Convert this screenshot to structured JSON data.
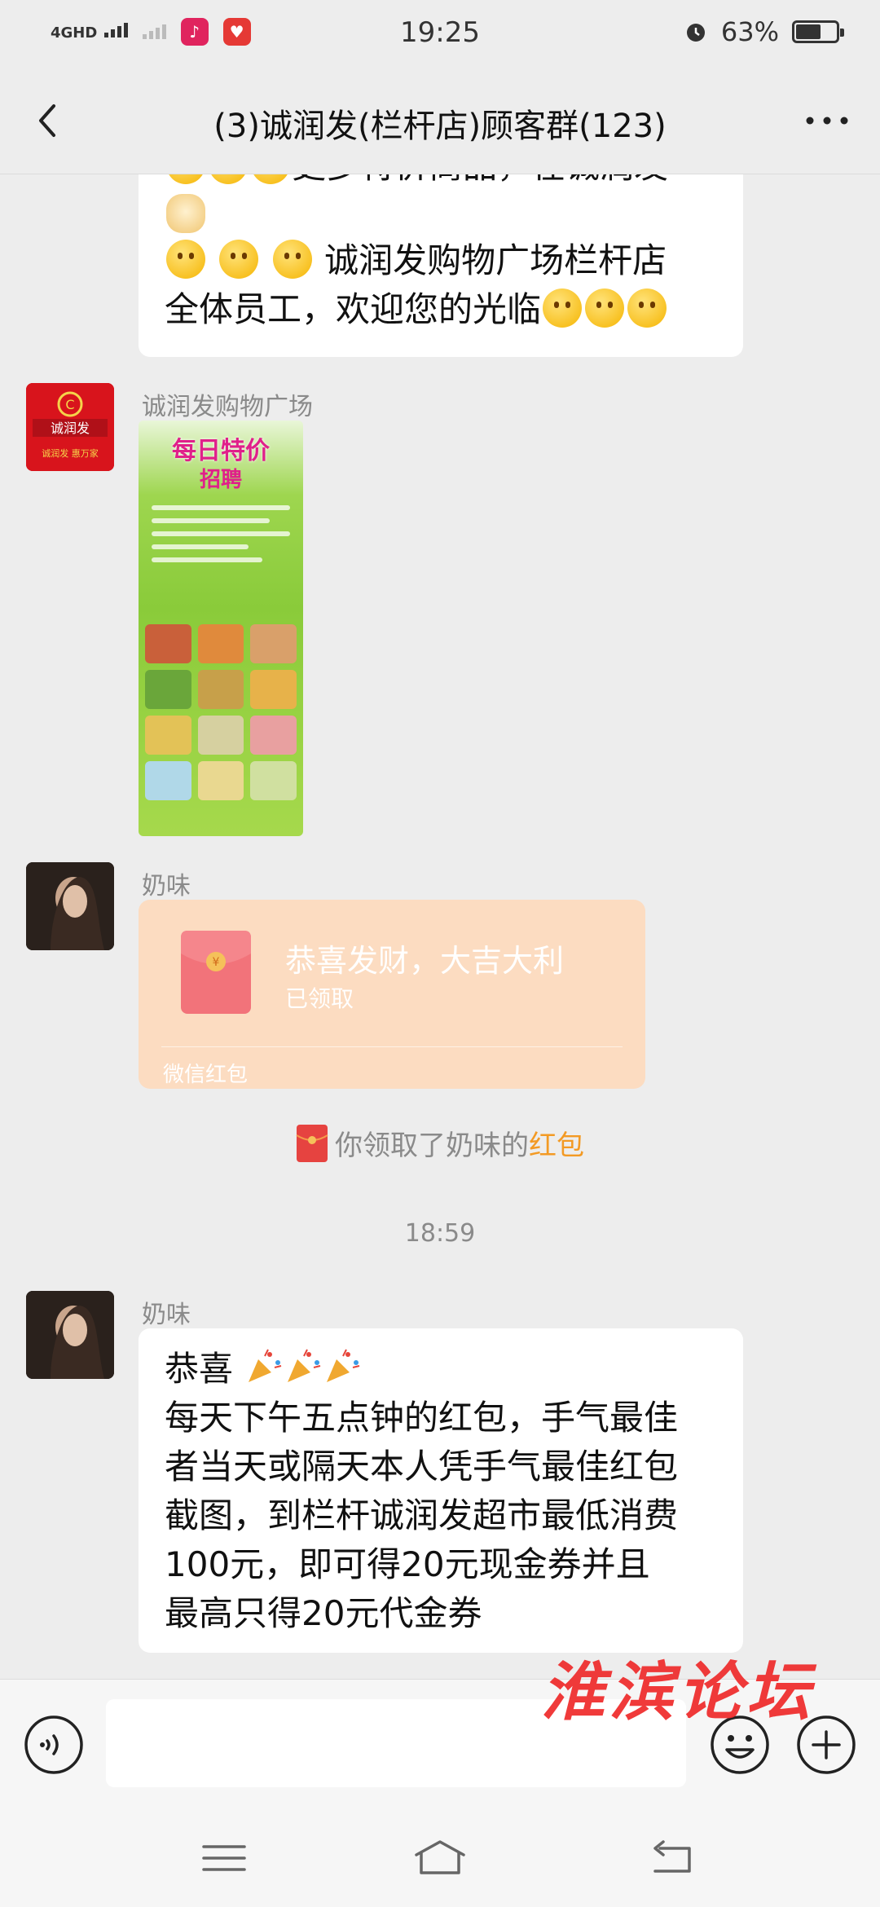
{
  "status_bar": {
    "network": "4GHD",
    "time": "19:25",
    "battery": "63%",
    "battery_level": 0.63
  },
  "nav": {
    "title": "(3)诚润发(栏杆店)顾客群(123)",
    "back_icon": "chevron-left-icon",
    "more_icon": "more-dots-icon"
  },
  "messages": {
    "prev_text_partial": "更多特价商品，在诚润发",
    "prev_text_line2": "诚润发购物广场栏杆店",
    "prev_text_line3": "全体员工，欢迎您的光临",
    "poster": {
      "sender": "诚润发购物广场",
      "avatar_line1": "诚润发",
      "avatar_line2": "诚润发 惠万家",
      "poster_title": "每日特价",
      "poster_subtitle": "招聘"
    },
    "red_packet": {
      "sender": "奶味",
      "title": "恭喜发财，大吉大利",
      "status": "已领取",
      "footer": "微信红包",
      "symbol": "¥"
    },
    "system_notice": {
      "prefix": "你领取了奶味的",
      "highlight": "红包"
    },
    "time_separator": "18:59",
    "last": {
      "sender": "奶味",
      "line1": "恭喜",
      "line2": "每天下午五点钟的红包，手气最佳",
      "line3": "者当天或隔天本人凭手气最佳红包",
      "line4": "截图，到栏杆诚润发超市最低消费",
      "line5": "100元，即可得20元现金券并且",
      "line6": "最高只得20元代金券"
    }
  },
  "input_bar": {
    "placeholder": "",
    "voice_icon": "voice-icon",
    "emoji_icon": "emoji-icon",
    "plus_icon": "plus-icon"
  },
  "watermark": "淮滨论坛",
  "colors": {
    "background": "#ededed",
    "bubble": "#ffffff",
    "red_packet_opened": "#fcdcc1",
    "highlight": "#f39a24",
    "watermark": "#ef2a2a"
  }
}
